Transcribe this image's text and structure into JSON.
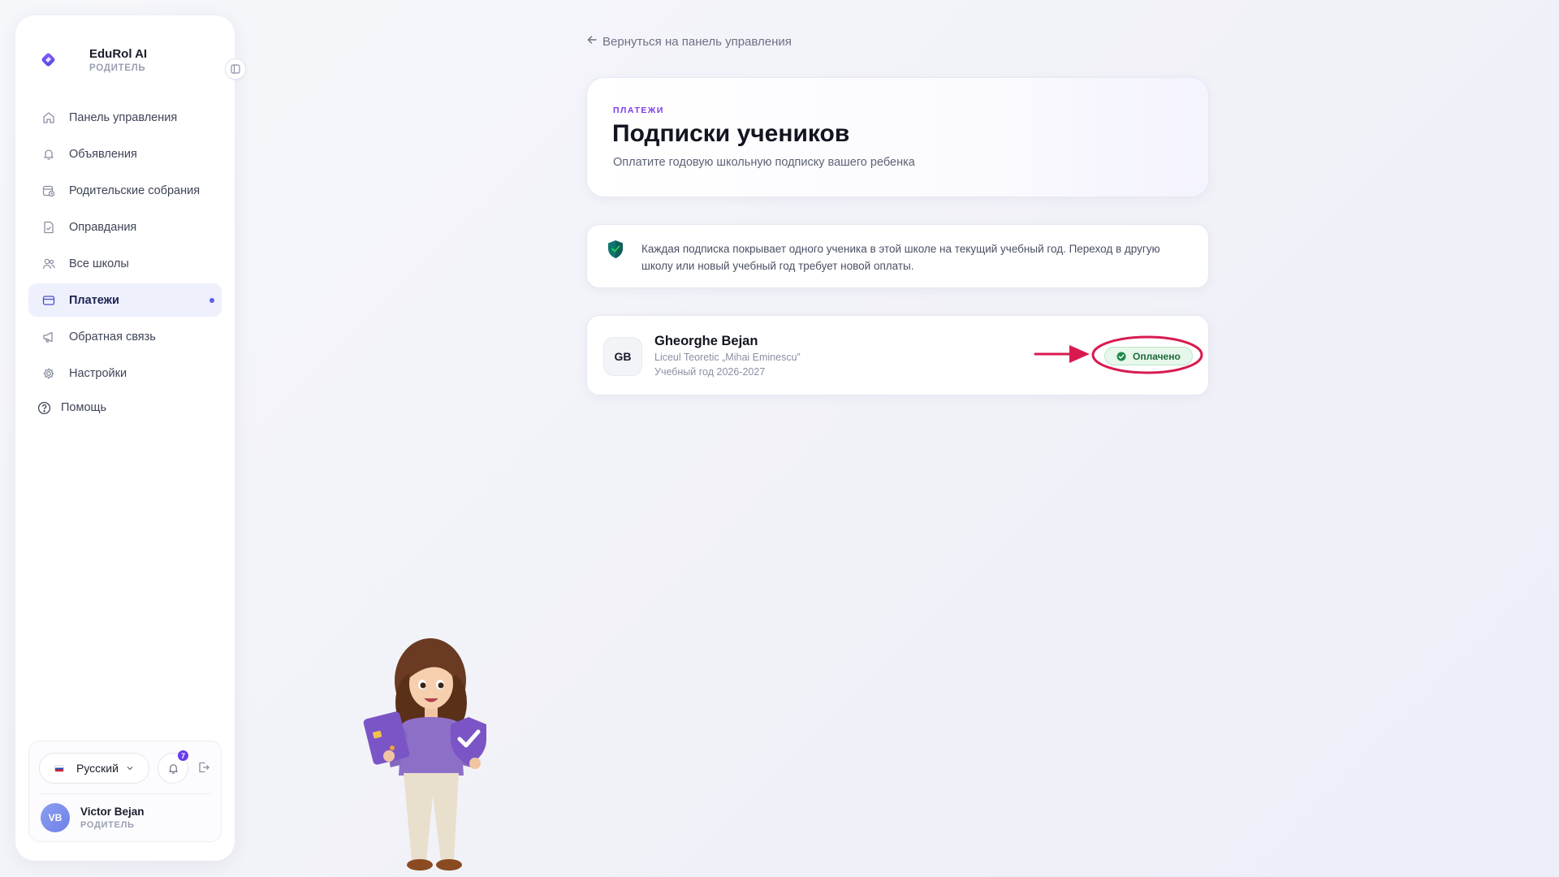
{
  "app": {
    "name": "EduRol AI",
    "role": "РОДИТЕЛЬ"
  },
  "sidebar": {
    "items": [
      {
        "label": "Панель управления",
        "icon": "home-icon"
      },
      {
        "label": "Объявления",
        "icon": "bell-icon"
      },
      {
        "label": "Родительские собрания",
        "icon": "calendar-clock-icon"
      },
      {
        "label": "Оправдания",
        "icon": "document-check-icon"
      },
      {
        "label": "Все школы",
        "icon": "users-icon"
      },
      {
        "label": "Платежи",
        "icon": "credit-card-icon",
        "active": true
      },
      {
        "label": "Обратная связь",
        "icon": "megaphone-icon"
      },
      {
        "label": "Настройки",
        "icon": "gear-icon"
      }
    ],
    "help": {
      "label": "Помощь",
      "icon": "help-circle-icon"
    }
  },
  "footer": {
    "language": "Русский",
    "notifications_count": "7",
    "user": {
      "initials": "VB",
      "name": "Victor Bejan",
      "role": "РОДИТЕЛЬ"
    }
  },
  "main": {
    "back_link": "Вернуться на панель управления",
    "header": {
      "eyebrow": "ПЛАТЕЖИ",
      "title": "Подписки учеников",
      "subtitle": "Оплатите годовую школьную подписку вашего ребенка"
    },
    "info": {
      "text": "Каждая подписка покрывает одного ученика в этой школе на текущий учебный год. Переход в другую школу или новый учебный год требует новой оплаты."
    },
    "students": [
      {
        "initials": "GB",
        "name": "Gheorghe Bejan",
        "school": "Liceul Teoretic „Mihai Eminescu”",
        "year": "Учебный год 2026-2027",
        "status": "Оплачено"
      }
    ]
  },
  "colors": {
    "accent": "#5b5ef0",
    "eyebrow": "#7c3aed",
    "paid": "#1c6b3a",
    "annotation": "#d81b4f"
  }
}
